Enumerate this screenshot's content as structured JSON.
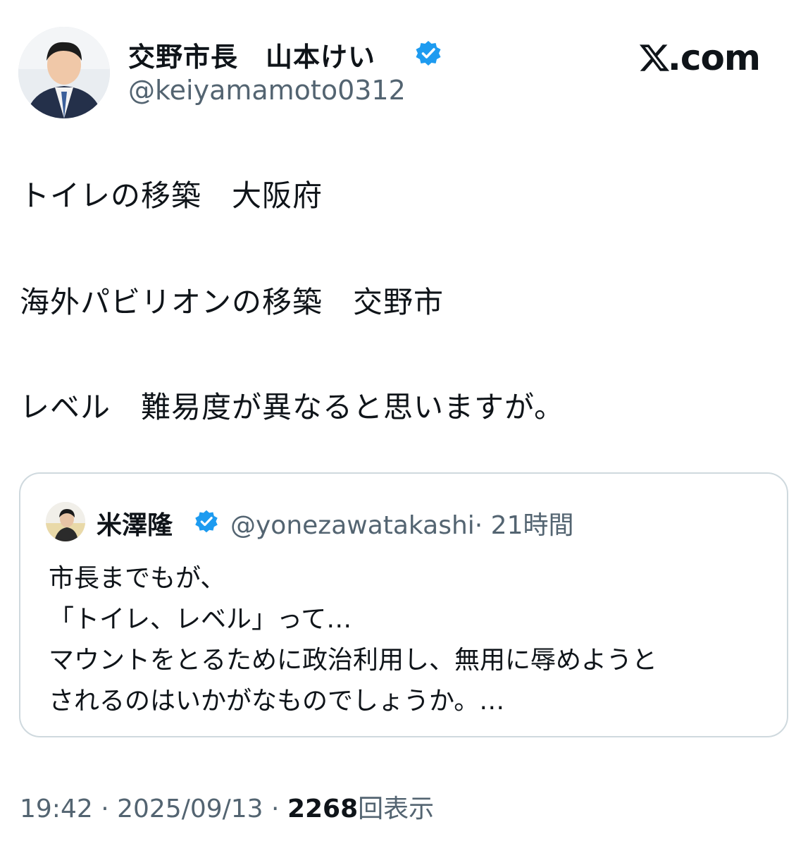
{
  "header": {
    "author_name": "交野市長　山本けい",
    "author_handle": "@keiyamamoto0312",
    "brand": ".com"
  },
  "post": {
    "lines": [
      "トイレの移築　大阪府",
      "海外パビリオンの移築　交野市",
      "レベル　難易度が異なると思いますが。"
    ]
  },
  "quote": {
    "name": "米澤隆",
    "handle": "@yonezawatakashi",
    "time": "· 21時間",
    "lines": [
      "市長までもが、",
      "「トイレ、レベル」って…",
      "マウントをとるために政治利用し、無用に辱めようと",
      "されるのはいかがなものでしょうか。…"
    ]
  },
  "meta": {
    "time": "19:42",
    "sep1": " · ",
    "date": "2025/09/13",
    "sep2": " · ",
    "views": "2268",
    "views_label": "回表示"
  },
  "colors": {
    "verified": "#1d9bf0",
    "secondary_text": "#536471",
    "border": "#cfd9de"
  },
  "icons": [
    "verified-badge-icon",
    "x-logo-icon"
  ]
}
